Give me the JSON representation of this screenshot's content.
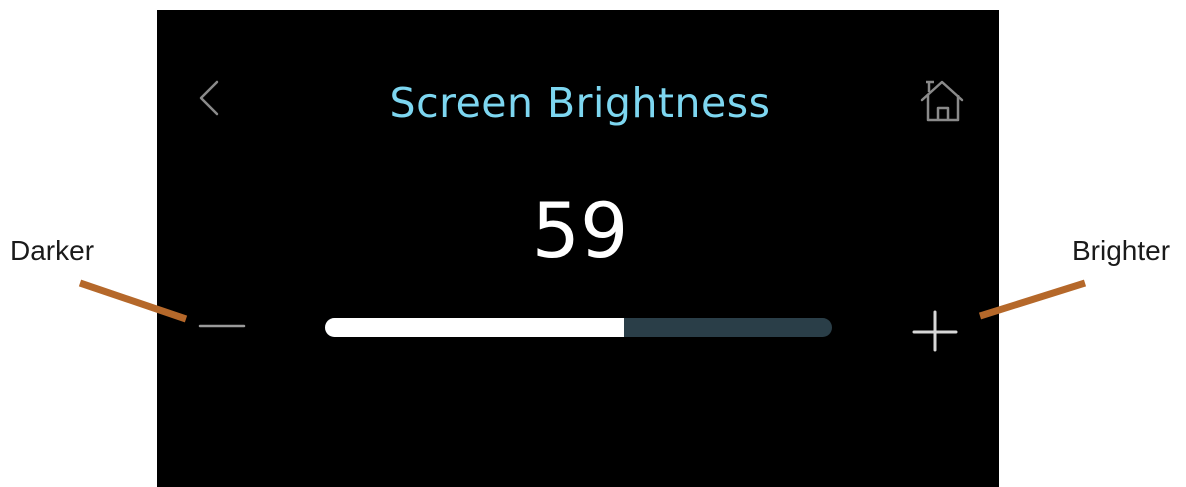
{
  "screen": {
    "title": "Screen Brightness",
    "brightness_value": "59",
    "brightness_level_percent": 59,
    "title_color": "#7dd6f0",
    "track_color": "#2a3e48",
    "fill_color": "#ffffff",
    "background_color": "#000000"
  },
  "icons": {
    "back": "back-chevron-icon",
    "home": "home-icon",
    "minus": "minus-icon",
    "plus": "plus-icon"
  },
  "callouts": {
    "darker_label": "Darker",
    "brighter_label": "Brighter",
    "line_color": "#b5682a"
  }
}
